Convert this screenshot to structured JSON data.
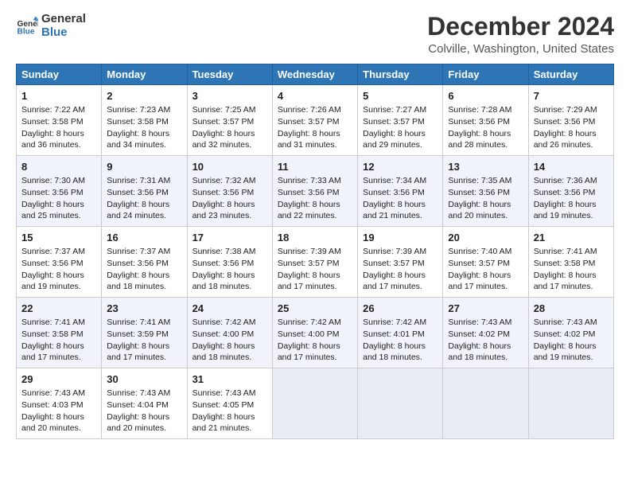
{
  "logo": {
    "line1": "General",
    "line2": "Blue"
  },
  "title": "December 2024",
  "subtitle": "Colville, Washington, United States",
  "headers": [
    "Sunday",
    "Monday",
    "Tuesday",
    "Wednesday",
    "Thursday",
    "Friday",
    "Saturday"
  ],
  "weeks": [
    [
      {
        "day": "1",
        "sunrise": "7:22 AM",
        "sunset": "3:58 PM",
        "daylight": "8 hours and 36 minutes."
      },
      {
        "day": "2",
        "sunrise": "7:23 AM",
        "sunset": "3:58 PM",
        "daylight": "8 hours and 34 minutes."
      },
      {
        "day": "3",
        "sunrise": "7:25 AM",
        "sunset": "3:57 PM",
        "daylight": "8 hours and 32 minutes."
      },
      {
        "day": "4",
        "sunrise": "7:26 AM",
        "sunset": "3:57 PM",
        "daylight": "8 hours and 31 minutes."
      },
      {
        "day": "5",
        "sunrise": "7:27 AM",
        "sunset": "3:57 PM",
        "daylight": "8 hours and 29 minutes."
      },
      {
        "day": "6",
        "sunrise": "7:28 AM",
        "sunset": "3:56 PM",
        "daylight": "8 hours and 28 minutes."
      },
      {
        "day": "7",
        "sunrise": "7:29 AM",
        "sunset": "3:56 PM",
        "daylight": "8 hours and 26 minutes."
      }
    ],
    [
      {
        "day": "8",
        "sunrise": "7:30 AM",
        "sunset": "3:56 PM",
        "daylight": "8 hours and 25 minutes."
      },
      {
        "day": "9",
        "sunrise": "7:31 AM",
        "sunset": "3:56 PM",
        "daylight": "8 hours and 24 minutes."
      },
      {
        "day": "10",
        "sunrise": "7:32 AM",
        "sunset": "3:56 PM",
        "daylight": "8 hours and 23 minutes."
      },
      {
        "day": "11",
        "sunrise": "7:33 AM",
        "sunset": "3:56 PM",
        "daylight": "8 hours and 22 minutes."
      },
      {
        "day": "12",
        "sunrise": "7:34 AM",
        "sunset": "3:56 PM",
        "daylight": "8 hours and 21 minutes."
      },
      {
        "day": "13",
        "sunrise": "7:35 AM",
        "sunset": "3:56 PM",
        "daylight": "8 hours and 20 minutes."
      },
      {
        "day": "14",
        "sunrise": "7:36 AM",
        "sunset": "3:56 PM",
        "daylight": "8 hours and 19 minutes."
      }
    ],
    [
      {
        "day": "15",
        "sunrise": "7:37 AM",
        "sunset": "3:56 PM",
        "daylight": "8 hours and 19 minutes."
      },
      {
        "day": "16",
        "sunrise": "7:37 AM",
        "sunset": "3:56 PM",
        "daylight": "8 hours and 18 minutes."
      },
      {
        "day": "17",
        "sunrise": "7:38 AM",
        "sunset": "3:56 PM",
        "daylight": "8 hours and 18 minutes."
      },
      {
        "day": "18",
        "sunrise": "7:39 AM",
        "sunset": "3:57 PM",
        "daylight": "8 hours and 17 minutes."
      },
      {
        "day": "19",
        "sunrise": "7:39 AM",
        "sunset": "3:57 PM",
        "daylight": "8 hours and 17 minutes."
      },
      {
        "day": "20",
        "sunrise": "7:40 AM",
        "sunset": "3:57 PM",
        "daylight": "8 hours and 17 minutes."
      },
      {
        "day": "21",
        "sunrise": "7:41 AM",
        "sunset": "3:58 PM",
        "daylight": "8 hours and 17 minutes."
      }
    ],
    [
      {
        "day": "22",
        "sunrise": "7:41 AM",
        "sunset": "3:58 PM",
        "daylight": "8 hours and 17 minutes."
      },
      {
        "day": "23",
        "sunrise": "7:41 AM",
        "sunset": "3:59 PM",
        "daylight": "8 hours and 17 minutes."
      },
      {
        "day": "24",
        "sunrise": "7:42 AM",
        "sunset": "4:00 PM",
        "daylight": "8 hours and 18 minutes."
      },
      {
        "day": "25",
        "sunrise": "7:42 AM",
        "sunset": "4:00 PM",
        "daylight": "8 hours and 17 minutes."
      },
      {
        "day": "26",
        "sunrise": "7:42 AM",
        "sunset": "4:01 PM",
        "daylight": "8 hours and 18 minutes."
      },
      {
        "day": "27",
        "sunrise": "7:43 AM",
        "sunset": "4:02 PM",
        "daylight": "8 hours and 18 minutes."
      },
      {
        "day": "28",
        "sunrise": "7:43 AM",
        "sunset": "4:02 PM",
        "daylight": "8 hours and 19 minutes."
      }
    ],
    [
      {
        "day": "29",
        "sunrise": "7:43 AM",
        "sunset": "4:03 PM",
        "daylight": "8 hours and 20 minutes."
      },
      {
        "day": "30",
        "sunrise": "7:43 AM",
        "sunset": "4:04 PM",
        "daylight": "8 hours and 20 minutes."
      },
      {
        "day": "31",
        "sunrise": "7:43 AM",
        "sunset": "4:05 PM",
        "daylight": "8 hours and 21 minutes."
      },
      null,
      null,
      null,
      null
    ]
  ],
  "labels": {
    "sunrise": "Sunrise:",
    "sunset": "Sunset:",
    "daylight": "Daylight:"
  }
}
